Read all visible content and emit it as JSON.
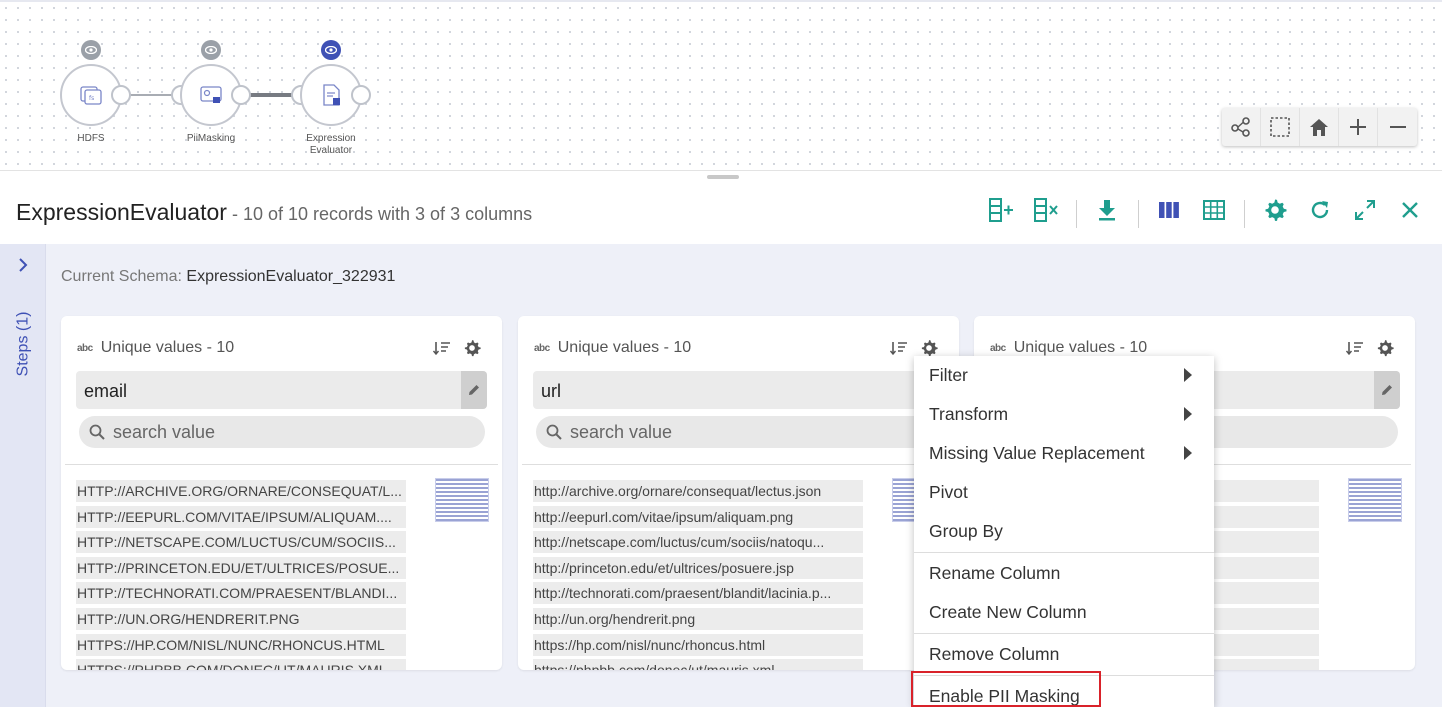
{
  "pipeline": {
    "nodes": [
      {
        "label": "HDFS",
        "preview": "inactive"
      },
      {
        "label": "PiiMasking",
        "preview": "inactive"
      },
      {
        "label": "Expression Evaluator",
        "preview": "active"
      }
    ]
  },
  "header": {
    "title": "ExpressionEvaluator",
    "subtitle": " - 10 of 10 records with 3 of 3 columns"
  },
  "steps": {
    "label": "Steps (1)"
  },
  "schema": {
    "prefix": "Current Schema:",
    "name": "ExpressionEvaluator_322931"
  },
  "columns": [
    {
      "unique_label": "Unique values - 10",
      "name": "email",
      "search_placeholder": "search value",
      "values": [
        "HTTP://ARCHIVE.ORG/ORNARE/CONSEQUAT/L...",
        "HTTP://EEPURL.COM/VITAE/IPSUM/ALIQUAM....",
        "HTTP://NETSCAPE.COM/LUCTUS/CUM/SOCIIS...",
        "HTTP://PRINCETON.EDU/ET/ULTRICES/POSUE...",
        "HTTP://TECHNORATI.COM/PRAESENT/BLANDI...",
        "HTTP://UN.ORG/HENDRERIT.PNG",
        "HTTPS://HP.COM/NISL/NUNC/RHONCUS.HTML",
        "HTTPS://PHPBB.COM/DONEC/UT/MAURIS.XML"
      ]
    },
    {
      "unique_label": "Unique values - 10",
      "name": "url",
      "search_placeholder": "search value",
      "values": [
        "http://archive.org/ornare/consequat/lectus.json",
        "http://eepurl.com/vitae/ipsum/aliquam.png",
        "http://netscape.com/luctus/cum/sociis/natoqu...",
        "http://princeton.edu/et/ultrices/posuere.jsp",
        "http://technorati.com/praesent/blandit/lacinia.p...",
        "http://un.org/hendrerit.png",
        "https://hp.com/nisl/nunc/rhoncus.html",
        "https://phpbb.com/donec/ut/mauris.xml"
      ]
    },
    {
      "unique_label": "Unique values - 10",
      "name": "",
      "search_placeholder": "",
      "values": []
    }
  ],
  "context_menu": {
    "items": [
      {
        "label": "Filter",
        "submenu": true
      },
      {
        "label": "Transform",
        "submenu": true
      },
      {
        "label": "Missing Value Replacement",
        "submenu": true
      },
      {
        "label": "Pivot",
        "submenu": false
      },
      {
        "label": "Group By",
        "submenu": false
      },
      {
        "label": "Rename Column",
        "submenu": false
      },
      {
        "label": "Create New Column",
        "submenu": false
      },
      {
        "label": "Remove Column",
        "submenu": false
      },
      {
        "label": "Enable PII Masking",
        "submenu": false
      }
    ]
  },
  "colors": {
    "accent_teal": "#1f9e8e",
    "accent_indigo": "#3f51b5",
    "highlight_red": "#d9222a"
  }
}
